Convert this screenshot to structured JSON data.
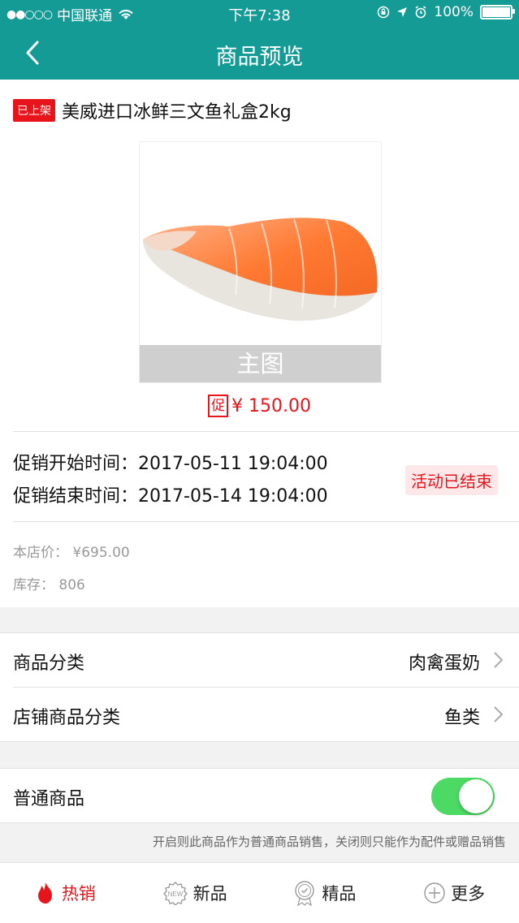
{
  "status_bar": {
    "signal_dots": "●●○○○",
    "carrier": "中国联通",
    "time": "下午7:38",
    "battery_percent": "100%",
    "battery_level": 1.0
  },
  "navbar": {
    "title": "商品预览"
  },
  "product": {
    "status_tag": "已上架",
    "name": "美威进口冰鲜三文鱼礼盒2kg",
    "image_label": "主图",
    "promo_tag": "促",
    "promo_price": "¥ 150.00",
    "promo_start_label": "促销开始时间：",
    "promo_start": "2017-05-11 19:04:00",
    "promo_end_label": "促销结束时间：",
    "promo_end": "2017-05-14 19:04:00",
    "promo_status": "活动已结束",
    "store_price_label": "本店价：",
    "store_price": "¥695.00",
    "stock_label": "库存：",
    "stock": "806"
  },
  "category_group": {
    "items": [
      {
        "label": "商品分类",
        "value": "肉禽蛋奶"
      },
      {
        "label": "店铺商品分类",
        "value": "鱼类"
      }
    ]
  },
  "normal_goods": {
    "label": "普通商品",
    "enabled": true,
    "hint": "开启则此商品作为普通商品销售，关闭则只能作为配件或赠品销售"
  },
  "tabbar": {
    "items": [
      {
        "label": "热销",
        "icon": "flame-icon",
        "active": true
      },
      {
        "label": "新品",
        "icon": "new-badge-icon",
        "active": false
      },
      {
        "label": "精品",
        "icon": "quality-badge-icon",
        "active": false
      },
      {
        "label": "更多",
        "icon": "plus-circle-icon",
        "active": false
      }
    ]
  },
  "colors": {
    "theme": "#159b96",
    "accent_red": "#e8141b",
    "toggle_on": "#4cd964"
  }
}
